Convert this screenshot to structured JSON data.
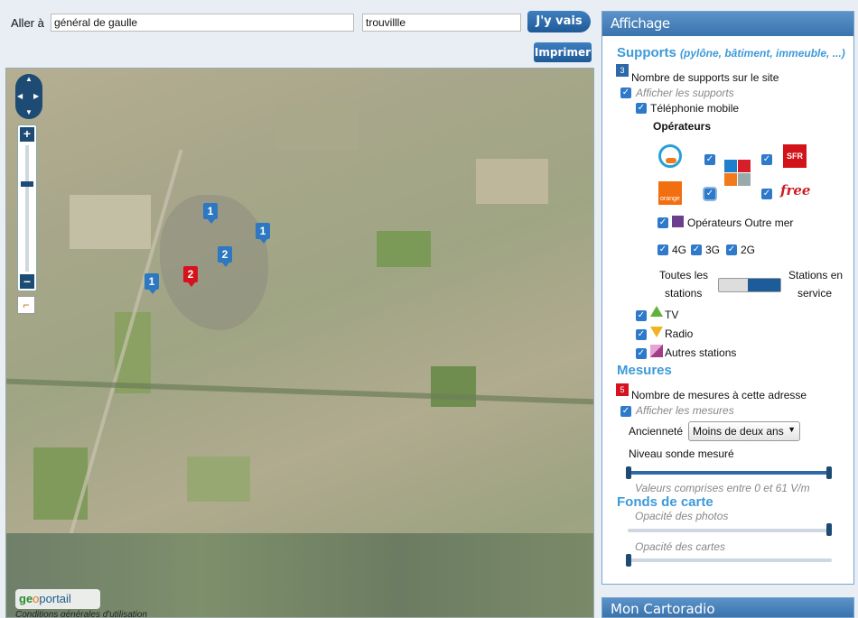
{
  "search": {
    "label": "Aller à",
    "address_value": "général de gaulle",
    "city_value": "trouvillle",
    "go_label": "J'y vais",
    "print_label": "Imprimer"
  },
  "map": {
    "markers": [
      "1",
      "1",
      "2",
      "1",
      "2"
    ],
    "logo_geo": "ge",
    "logo_o": "o",
    "logo_portail": "portail",
    "cgu_link": "Conditions générales d'utilisation"
  },
  "panel": {
    "title": "Affichage",
    "supports": {
      "title": "Supports",
      "subtitle": "(pylône, bâtiment, immeuble, ...)",
      "count_badge": "3",
      "count_label": "Nombre de supports sur le site",
      "show_label": "Afficher les supports",
      "mobile_label": "Téléphonie mobile",
      "operators_title": "Opérateurs",
      "operators": [
        "Bouygues",
        "SFR",
        "Orange",
        "Free"
      ],
      "sfr_text": "SFR",
      "orange_text": "orange",
      "free_text": "free",
      "outremer_label": "Opérateurs Outre mer",
      "tech": [
        "4G",
        "3G",
        "2G"
      ],
      "toggle_left_1": "Toutes les",
      "toggle_left_2": "stations",
      "toggle_right_1": "Stations en",
      "toggle_right_2": "service",
      "tv_label": "TV",
      "radio_label": "Radio",
      "other_label": "Autres stations"
    },
    "mesures": {
      "title": "Mesures",
      "count_badge": "5",
      "count_label": "Nombre de mesures à cette adresse",
      "show_label": "Afficher les mesures",
      "age_label": "Ancienneté",
      "age_value": "Moins de deux ans",
      "level_label": "Niveau sonde mesuré",
      "range_text": "Valeurs comprises entre 0 et 61 V/m"
    },
    "fonds": {
      "title": "Fonds de carte",
      "photo_opacity_label": "Opacité des photos",
      "photo_opacity": 1.0,
      "map_opacity_label": "Opacité des cartes",
      "map_opacity": 0.0
    }
  },
  "panel2": {
    "title": "Mon Cartoradio"
  },
  "colors": {
    "accent": "#3d9ad9",
    "header": "#3a74ad",
    "checkbox": "#2e79c9",
    "marker_red": "#d6121e"
  }
}
